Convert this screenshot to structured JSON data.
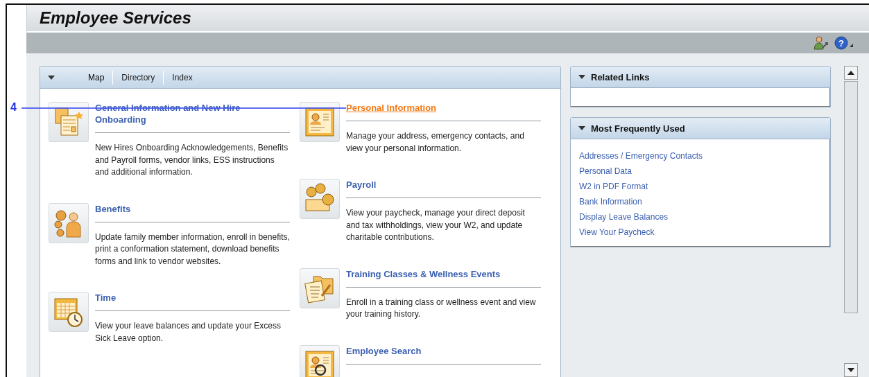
{
  "window": {
    "title": "Employee Services"
  },
  "toolbar": {
    "buttons": [
      {
        "kind": "personalize"
      },
      {
        "kind": "help",
        "label": "?"
      }
    ]
  },
  "callout": {
    "label": "4"
  },
  "services_panel": {
    "tabs": [
      {
        "label": "Map",
        "selected": true
      },
      {
        "label": "Directory",
        "selected": false
      },
      {
        "label": "Index",
        "selected": false
      }
    ],
    "columns": [
      [
        {
          "title": "General Information and New Hire Onboarding",
          "selected": false,
          "description": "New Hires Onboarding Acknowledgements, Benefits and Payroll forms, vendor links, ESS instructions and additional information."
        },
        {
          "title": "Benefits",
          "selected": false,
          "description": "Update family member information, enroll in benefits, print a conformation statement, download benefits forms and link to vendor websites."
        },
        {
          "title": "Time",
          "selected": false,
          "description": "View your leave balances and update your Excess Sick Leave option."
        }
      ],
      [
        {
          "title": "Personal Information",
          "selected": true,
          "description": "Manage your address, emergency contacts, and view your personal information."
        },
        {
          "title": "Payroll",
          "selected": false,
          "description": "View your paycheck, manage your direct deposit and tax withholdings, view your W2, and update charitable contributions."
        },
        {
          "title": "Training Classes & Wellness Events",
          "selected": false,
          "description": "Enroll in a training class or wellness event and view your training history."
        },
        {
          "title": "Employee Search",
          "selected": false
        }
      ]
    ]
  },
  "related_links": {
    "title": "Related Links"
  },
  "most_frequently_used": {
    "title": "Most Frequently Used",
    "links": [
      "Addresses / Emergency Contacts",
      "Personal Data",
      "W2 in PDF Format",
      "Bank Information",
      "Display Leave Balances",
      "View Your Paycheck"
    ]
  }
}
